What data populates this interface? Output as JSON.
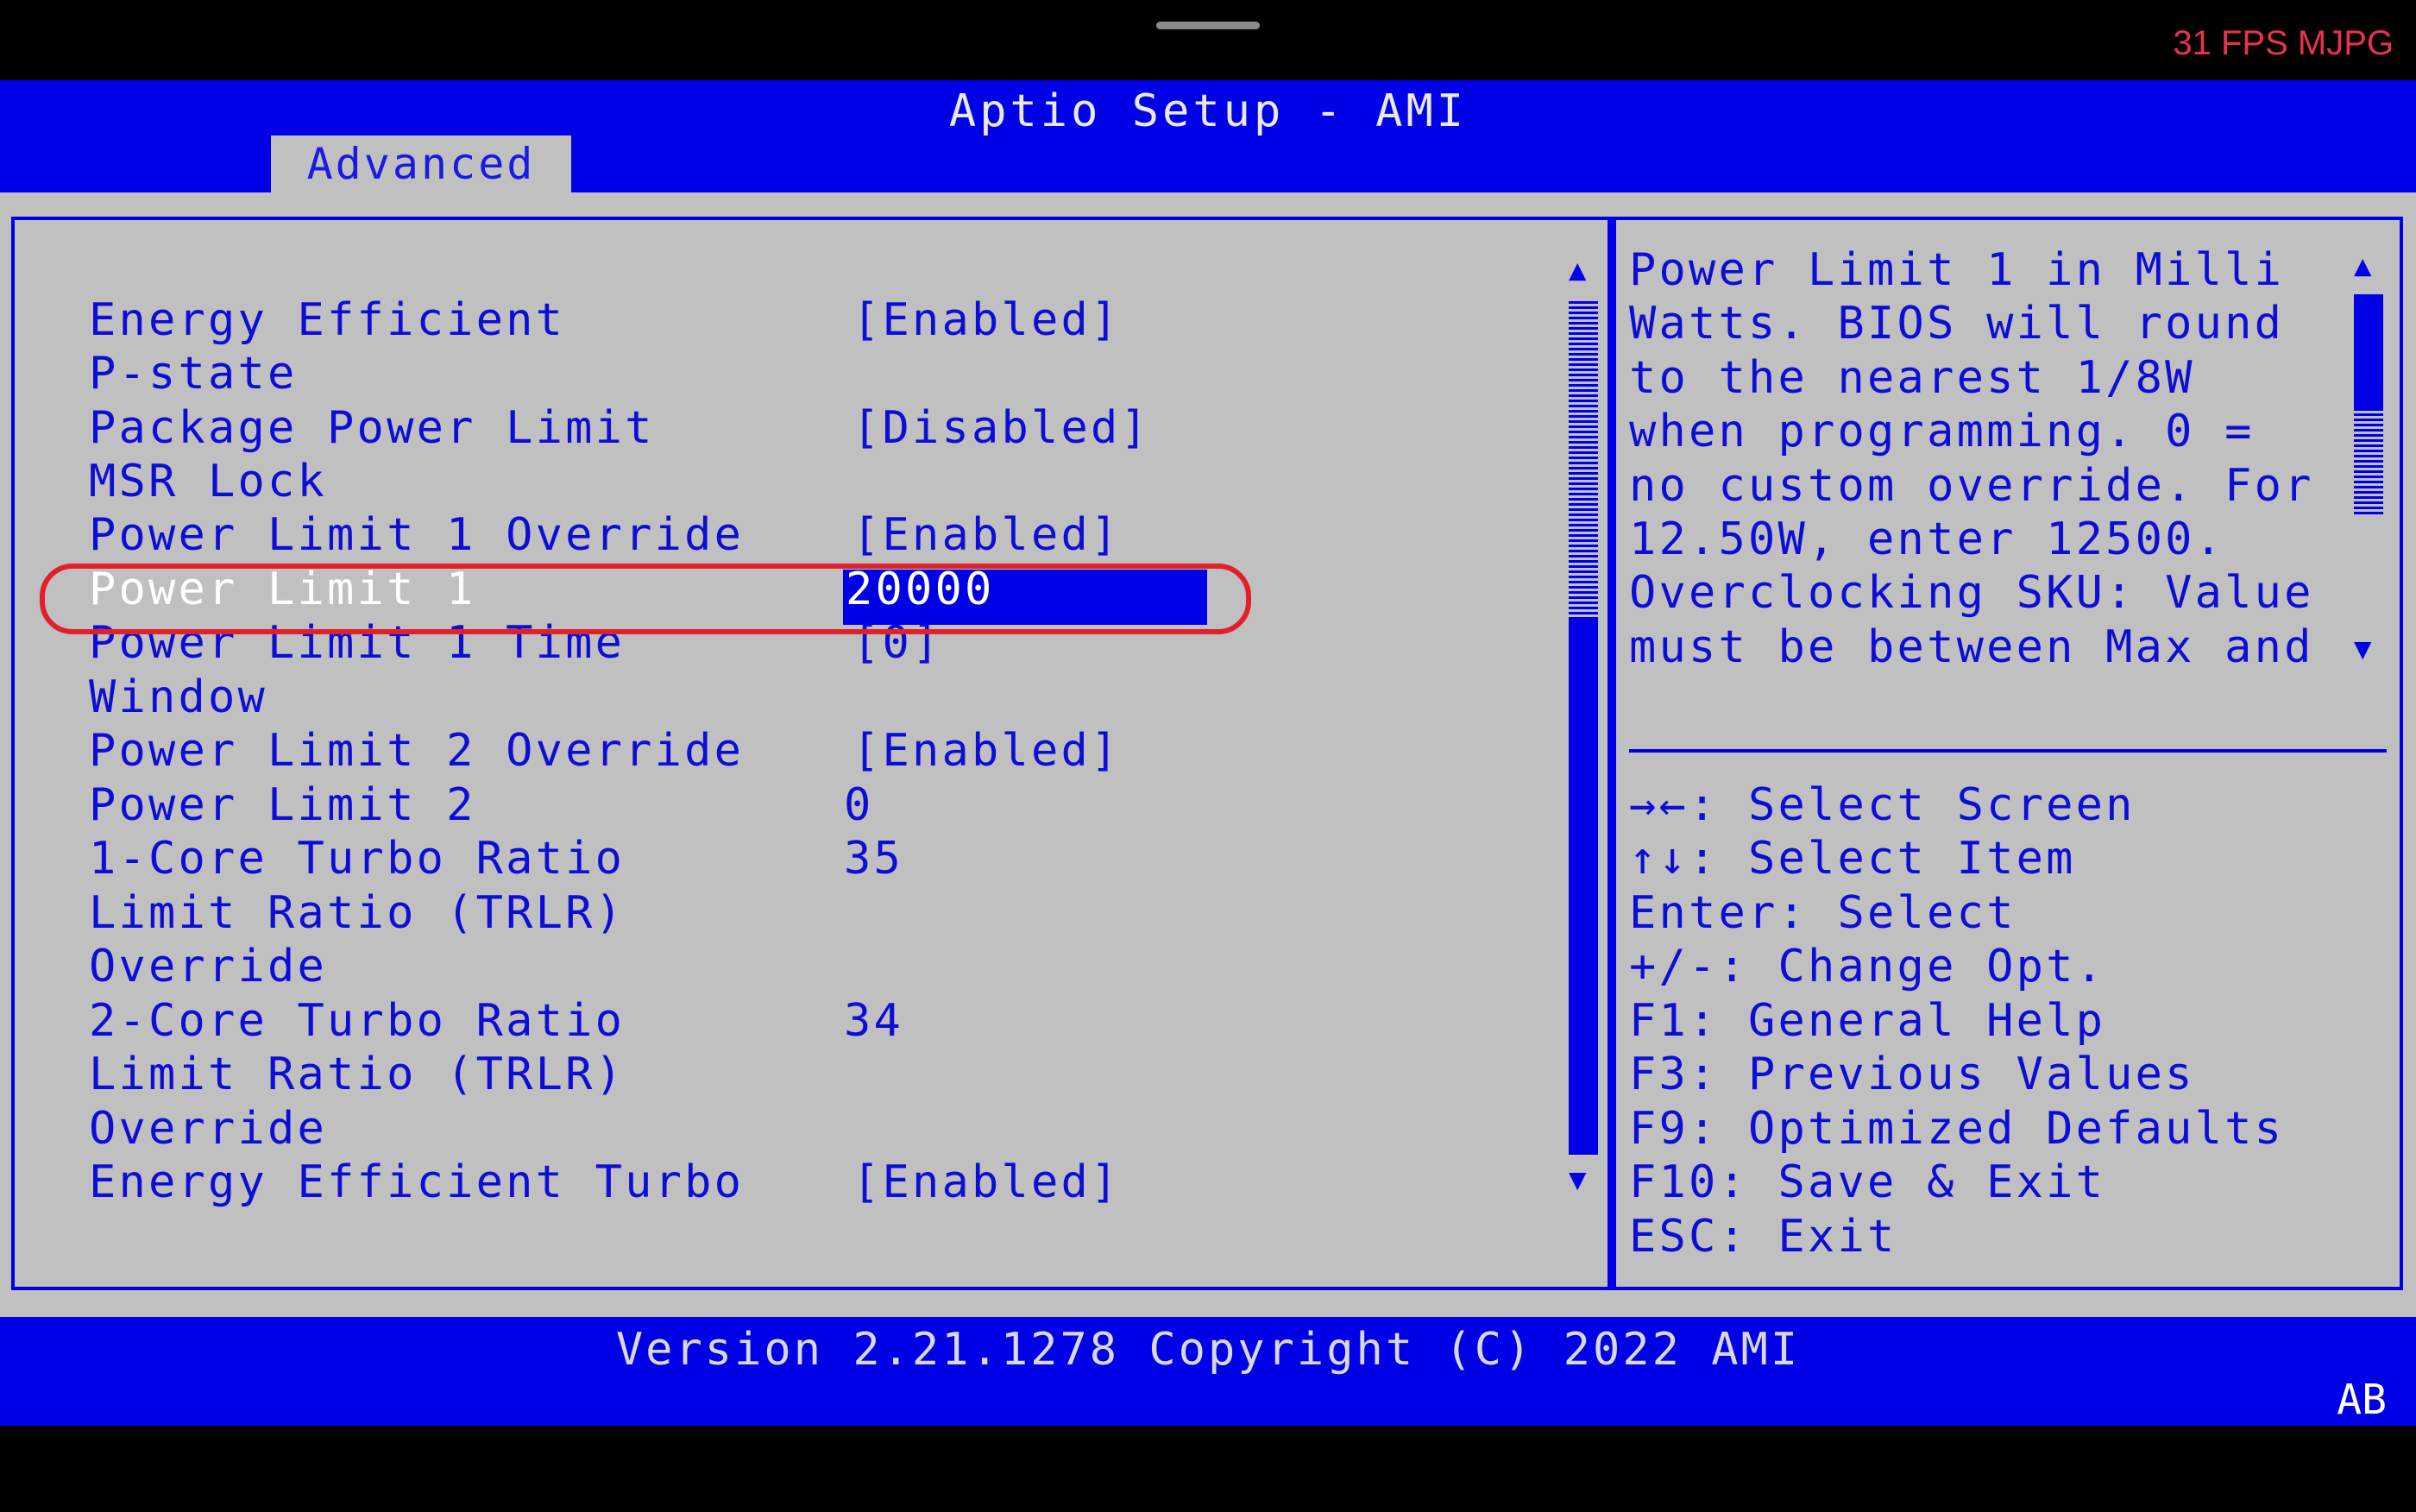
{
  "overlay": {
    "fps_label": "31 FPS MJPG"
  },
  "header": {
    "title": "Aptio Setup - AMI",
    "active_tab": "Advanced"
  },
  "settings": {
    "rows": [
      {
        "label": "Energy Efficient",
        "value": "[Enabled]"
      },
      {
        "label": "P-state",
        "value": ""
      },
      {
        "label": "Package Power Limit",
        "value": "[Disabled]"
      },
      {
        "label": "MSR Lock",
        "value": ""
      },
      {
        "label": "Power Limit 1 Override",
        "value": "[Enabled]"
      },
      {
        "label": "Power Limit 1",
        "value": "20000"
      },
      {
        "label": "Power Limit 1 Time",
        "value": "[0]"
      },
      {
        "label": "Window",
        "value": ""
      },
      {
        "label": "Power Limit 2 Override",
        "value": "[Enabled]"
      },
      {
        "label": "Power Limit 2",
        "value": "0"
      },
      {
        "label": "1-Core Turbo Ratio",
        "value": "35"
      },
      {
        "label": "Limit Ratio (TRLR)",
        "value": ""
      },
      {
        "label": "Override",
        "value": ""
      },
      {
        "label": "2-Core Turbo Ratio",
        "value": "34"
      },
      {
        "label": "Limit Ratio (TRLR)",
        "value": ""
      },
      {
        "label": "Override",
        "value": ""
      },
      {
        "label": "Energy Efficient Turbo",
        "value": "[Enabled]"
      }
    ],
    "selected_item": "Power Limit 1"
  },
  "help": {
    "lines": [
      "Power Limit 1 in Milli",
      "Watts. BIOS will round",
      "to the nearest 1/8W",
      "when programming. 0 =",
      "no custom override. For",
      "12.50W, enter 12500.",
      "Overclocking SKU: Value",
      "must be between Max and"
    ]
  },
  "keys": {
    "lines": [
      "→←: Select Screen",
      "↑↓: Select Item",
      "Enter: Select",
      "+/-: Change Opt.",
      "F1: General Help",
      "F3: Previous Values",
      "F9: Optimized Defaults",
      "F10: Save & Exit",
      "ESC: Exit"
    ]
  },
  "footer": {
    "version": "Version 2.21.1278 Copyright (C) 2022 AMI",
    "badge": "AB"
  },
  "icons": {
    "scroll_up": "scroll-up-arrow-icon",
    "scroll_down": "scroll-down-arrow-icon"
  },
  "colors": {
    "bios_blue": "#0000e6",
    "panel_gray": "#c0c0c0",
    "highlight_red": "#e0202a",
    "fps_red": "#e8334a"
  }
}
